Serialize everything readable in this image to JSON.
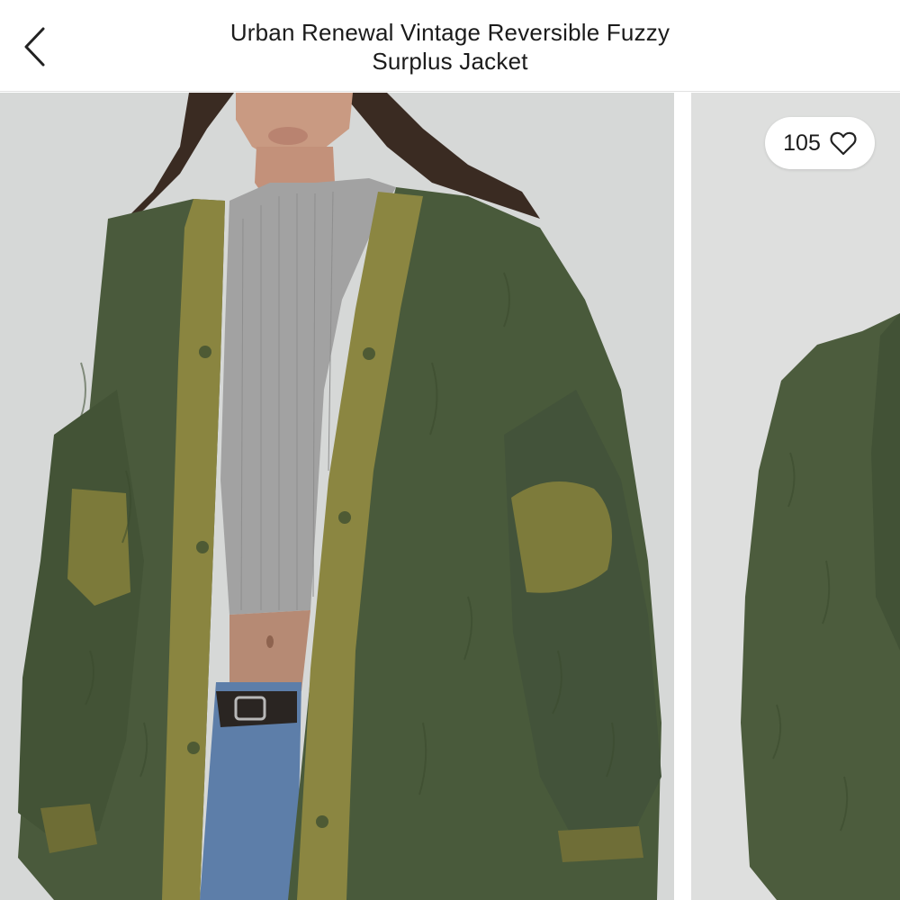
{
  "header": {
    "back_icon": "chevron-left-icon",
    "title_line1": "Urban Renewal Vintage Reversible Fuzzy",
    "title_line2": "Surplus Jacket"
  },
  "gallery": {
    "photos": [
      {
        "description_icon": "product-photo",
        "active": true
      },
      {
        "description_icon": "product-photo",
        "active": false
      }
    ]
  },
  "likes": {
    "count": "105",
    "icon": "heart-outline-icon"
  },
  "colors": {
    "fur": "#4a5a3c",
    "lining": "#7a7a3a",
    "shirt": "#9c9c9c",
    "denim": "#5e7ea8",
    "background": "#d7d9d8"
  }
}
